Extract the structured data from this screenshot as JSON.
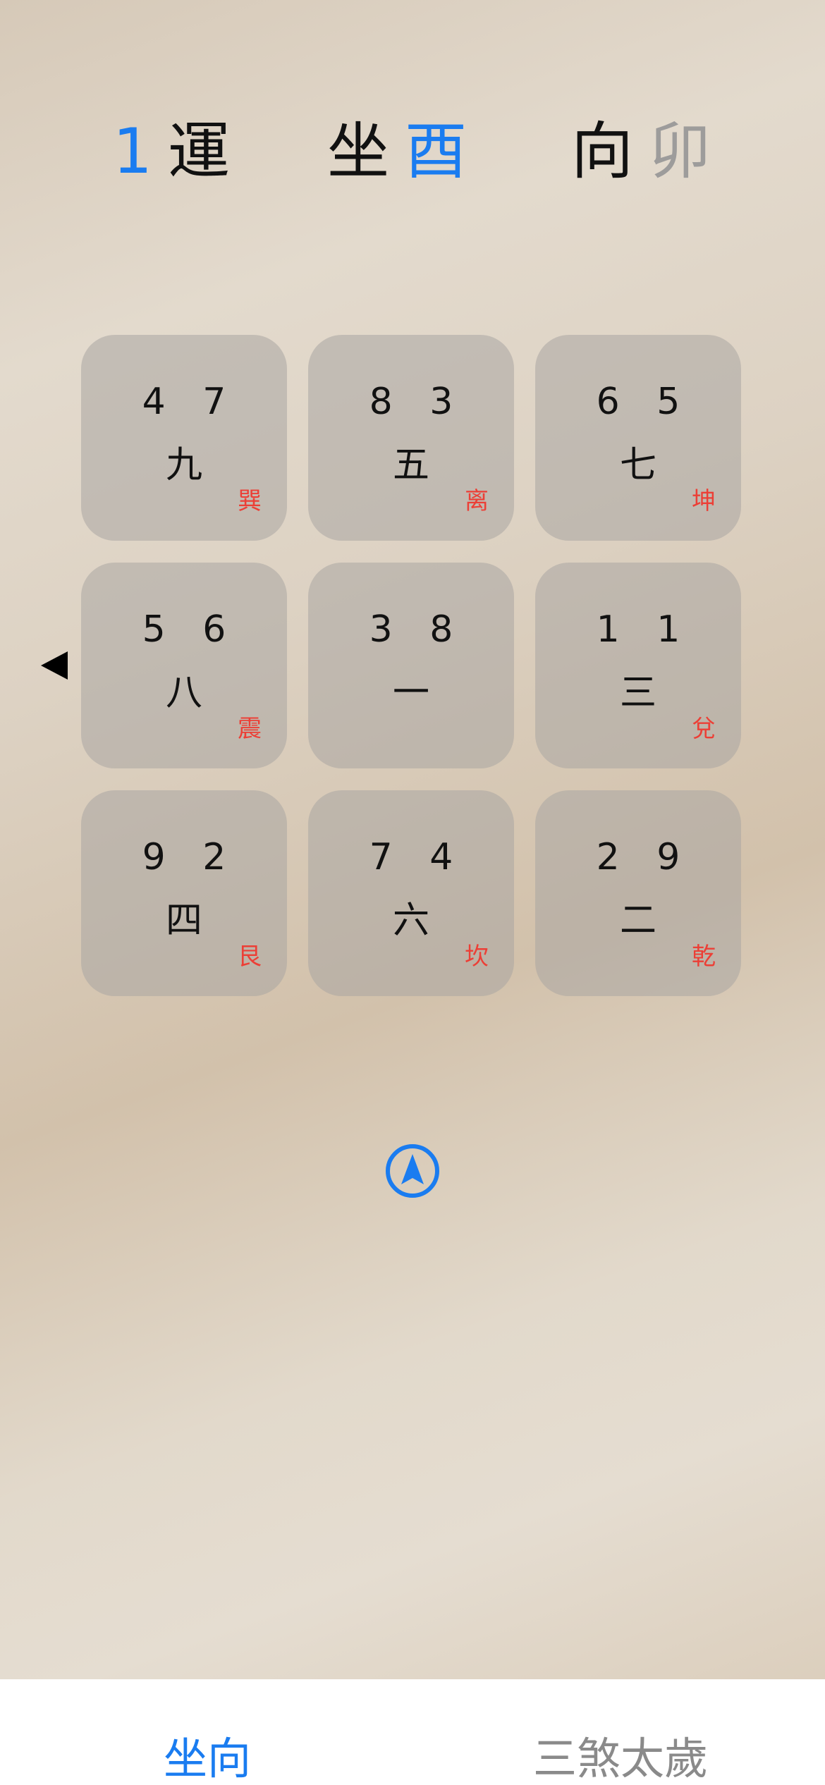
{
  "header": {
    "period_number": "1",
    "period_label": "運",
    "sit_label": "坐",
    "sit_value": "酉",
    "face_label": "向",
    "face_value": "卯"
  },
  "grid": [
    {
      "nums": "4 7",
      "star": "九",
      "trigram": "巽"
    },
    {
      "nums": "8 3",
      "star": "五",
      "trigram": "离"
    },
    {
      "nums": "6 5",
      "star": "七",
      "trigram": "坤"
    },
    {
      "nums": "5 6",
      "star": "八",
      "trigram": "震"
    },
    {
      "nums": "3 8",
      "star": "一",
      "trigram": ""
    },
    {
      "nums": "1 1",
      "star": "三",
      "trigram": "兌"
    },
    {
      "nums": "9 2",
      "star": "四",
      "trigram": "艮"
    },
    {
      "nums": "7 4",
      "star": "六",
      "trigram": "坎"
    },
    {
      "nums": "2 9",
      "star": "二",
      "trigram": "乾"
    }
  ],
  "icons": {
    "pointer": "left-triangle-icon",
    "compass": "location-arrow-icon"
  },
  "tabs": [
    {
      "label": "坐向",
      "active": true
    },
    {
      "label": "三煞太歲",
      "active": false
    }
  ],
  "colors": {
    "accent": "#1a7cf0",
    "trigram": "#ec3f36",
    "inactive": "#8a8a8a"
  }
}
